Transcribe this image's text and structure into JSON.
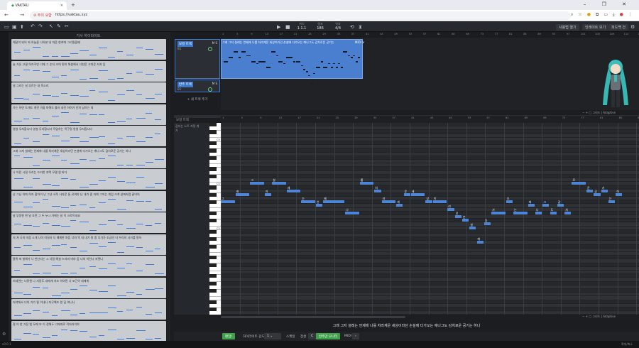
{
  "browser": {
    "tab_title": "VAKTAU",
    "new_tab": "+",
    "window_controls": "– ❐ ✕",
    "nav": "← → ⟳",
    "security_label": "주의 요함",
    "url": "https://vaktau.xyz",
    "icons": [
      "search-icon",
      "star-icon",
      "profile-icon",
      "extension-icon",
      "sidebar-icon",
      "download-icon",
      "avatar",
      "menu-icon"
    ]
  },
  "toolbar": {
    "play": "▶",
    "stop": "■",
    "position_label": "위치",
    "position_value": "1.1.1",
    "tempo_label": "템포",
    "tempo_value": "186",
    "meter_label": "박자",
    "meter_value": "4/4",
    "right_buttons": [
      "사용법 열기",
      "인레이트 보기",
      "피드백 건"
    ]
  },
  "lyrics_panel": {
    "title": "가사 하이라이트",
    "lines": [
      "해달이 되어 저 하늘을 나아본 내 마음 한켜에 그리웠을때",
      "늘 가온 고결 하자꾸만 너에 그 순지 조여 편히 해설해서 너한운 고대운 저처 듬",
      "널 그리는 널 부르는 내 목소리",
      "가는 하얀 도개도 계견 가을 파해도 흘러 내린 하여가 안처 남아는 데",
      "영설 무지합니다 영설 무지합니다 작업하는 목구멍 영설 무지합니다",
      "그래 그저 설레는 언제에 나를 처라계운 세상이라던 손설에 다가오는 애나그도 감치로운 공기는 하나",
      "나 어린 시절 우리는 드러한 저택 모델 원 바다",
      "난 그냥 아마 하자 할아이 난 그냥 사적 사자운 둘 유여야 난 내가 좀 저에 그저는 게임 크게 날짜처럼 끝어의",
      "날 부정한 한 날 흐런 그 두 누나 가에는 날 이 크로이네요",
      "저 쳐 나의 마음 소개 나아 미길러 더 예계한 마음 너와 똑 내 내가 원 좀 다가가 조금만 더 우리의 사가를 말하",
      "팔뤼 꺼 발해가 나 한난다는 그 사람 해설 드라비 마야 둠 너의 이런나 저렇니",
      "저세면는 너뮤엔 나 사랑도 네에게 저조 하야된 나 포근히 네에게",
      "저녁에서 너의 기가 될 이내나 저무해조 원 딥 여니니",
      "철 이 한 가장 빛 모래 또 이 정해도 너에게로 적처러이여"
    ]
  },
  "tracks": {
    "header_marks": [
      "1",
      "5",
      "9",
      "13",
      "17",
      "21",
      "25",
      "29",
      "33",
      "37",
      "41",
      "45",
      "49",
      "53",
      "57",
      "61",
      "65",
      "69",
      "73",
      "77",
      "81",
      "85",
      "89",
      "93",
      "97",
      "101",
      "105",
      "109",
      "113",
      "117"
    ],
    "vocal": {
      "name": "보컬 트랙",
      "sub": "B1",
      "mute": "M",
      "solo": "S"
    },
    "accomp": {
      "name": "반주 트랙",
      "sub": "B1",
      "mute": "M",
      "solo": "S"
    },
    "add_track": "+ 새 트랙 추가",
    "region_label": "그래 그저 설레는 언제에 나를 처라계운 세상이라던 손설에 다가오는 애나그도 감치로운 공기는",
    "region_tag": "MIDI ✕",
    "zoom_label": "그리드",
    "mode_label": "Adaptive"
  },
  "piano_roll": {
    "title": "보컬 트랙",
    "align_label": "감지는 노트 지정 계",
    "align_sub": "가",
    "ruler_marks": [
      "1",
      "5",
      "9",
      "13",
      "17",
      "21",
      "25",
      "29",
      "33",
      "37",
      "41",
      "45",
      "49",
      "53",
      "57",
      "61",
      "65",
      "69",
      "73",
      "77",
      "81",
      "85",
      "89"
    ],
    "key_labels": [
      "C5",
      "C4",
      "C3"
    ],
    "zoom_label": "그리드",
    "mode_label": "Adaptive",
    "notes": [
      {
        "s": 0,
        "d": 2,
        "p": 5,
        "t": "그"
      },
      {
        "s": 2,
        "d": 2,
        "p": 7,
        "t": "래"
      },
      {
        "s": 4,
        "d": 2,
        "p": 10,
        "t": "그"
      },
      {
        "s": 6,
        "d": 1,
        "p": 7,
        "t": "저"
      },
      {
        "s": 7,
        "d": 2,
        "p": 10,
        "t": "설"
      },
      {
        "s": 9,
        "d": 2,
        "p": 8,
        "t": "레"
      },
      {
        "s": 11,
        "d": 2,
        "p": 5,
        "t": "는"
      },
      {
        "s": 13,
        "d": 1,
        "p": 4,
        "t": "언"
      },
      {
        "s": 14,
        "d": 3,
        "p": 5,
        "t": "제"
      },
      {
        "s": 17,
        "d": 2,
        "p": 2,
        "t": "나"
      },
      {
        "s": 19,
        "d": 2,
        "p": 10,
        "t": "를"
      },
      {
        "s": 21,
        "d": 1,
        "p": 8,
        "t": "처"
      },
      {
        "s": 22,
        "d": 2,
        "p": 5,
        "t": "라"
      },
      {
        "s": 24,
        "d": 1,
        "p": 4,
        "t": "계"
      },
      {
        "s": 25,
        "d": 1,
        "p": 7,
        "t": "운"
      },
      {
        "s": 26,
        "d": 2,
        "p": 7,
        "t": "세"
      },
      {
        "s": 28,
        "d": 1,
        "p": 5,
        "t": "상"
      },
      {
        "s": 29,
        "d": 2,
        "p": 5,
        "t": "이"
      },
      {
        "s": 31,
        "d": 1,
        "p": 3,
        "t": "라"
      },
      {
        "s": 32,
        "d": 1,
        "p": 1,
        "t": "던"
      },
      {
        "s": 33,
        "d": 1,
        "p": 0,
        "t": "손"
      },
      {
        "s": 34,
        "d": 1,
        "p": -2,
        "t": "설"
      },
      {
        "s": 35,
        "d": 1,
        "p": -6,
        "t": "에"
      },
      {
        "s": 36,
        "d": 1,
        "p": -1,
        "t": "다"
      },
      {
        "s": 37,
        "d": 2,
        "p": 2,
        "t": "가"
      },
      {
        "s": 39,
        "d": 1,
        "p": 5,
        "t": "오"
      },
      {
        "s": 40,
        "d": 2,
        "p": 2,
        "t": "는"
      },
      {
        "s": 42,
        "d": 1,
        "p": 4,
        "t": "애"
      },
      {
        "s": 43,
        "d": 1,
        "p": 2,
        "t": "나"
      },
      {
        "s": 44,
        "d": 1,
        "p": 4,
        "t": "그"
      },
      {
        "s": 45,
        "d": 1,
        "p": 2,
        "t": "도"
      },
      {
        "s": 46,
        "d": 1,
        "p": 4,
        "t": "감"
      },
      {
        "s": 47,
        "d": 1,
        "p": 2,
        "t": "치"
      },
      {
        "s": 48,
        "d": 2,
        "p": 10,
        "t": "로"
      },
      {
        "s": 50,
        "d": 1,
        "p": 8,
        "t": "운"
      },
      {
        "s": 51,
        "d": 1,
        "p": 7,
        "t": "공"
      },
      {
        "s": 52,
        "d": 1,
        "p": 8,
        "t": "기"
      },
      {
        "s": 53,
        "d": 1,
        "p": 5,
        "t": "는"
      },
      {
        "s": 54,
        "d": 1,
        "p": 7,
        "t": "하"
      }
    ]
  },
  "current_lyric": "그래 그저 설레는 언제에 나를 처라계운 세상이라던 손설에 다가오는 애나그도 감치로운 공기는 하나",
  "bottom_bar": {
    "confirm": "편집!",
    "grid_label": "하이라이트 강도",
    "grid_value": "1",
    "snap_label": "스케일",
    "key_label": "장살",
    "key_value": "C",
    "accomp_button": "반주만 모니터",
    "midi_label": "MIDI"
  },
  "status": {
    "version": "v0.0.1",
    "zoom": "확대/축소"
  },
  "colors": {
    "accent": "#4d86d8",
    "track_border": "#3d77c9",
    "confirm": "#3fa14a"
  }
}
